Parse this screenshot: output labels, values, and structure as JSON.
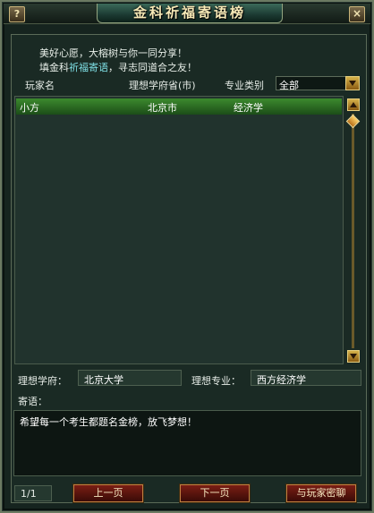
{
  "title": "金科祈福寄语榜",
  "help_label": "?",
  "close_label": "×",
  "intro": {
    "line1": "美好心愿，大榕树与你一同分享！",
    "line2_prefix": "填金科",
    "line2_highlight": "祈福寄语",
    "line2_suffix": "，寻志同道合之友！"
  },
  "header": {
    "player_col": "玩家名",
    "province_col": "理想学府省(市)",
    "major_col": "专业类别",
    "filter_value": "全部"
  },
  "rows": [
    {
      "player": "小方",
      "province": "北京市",
      "major": "经济学"
    }
  ],
  "details": {
    "school_label": "理想学府：",
    "school_value": "北京大学",
    "major_label": "理想专业：",
    "major_value": "西方经济学",
    "message_label": "寄语：",
    "message_value": "希望每一个考生都题名金榜，放飞梦想！"
  },
  "footer": {
    "page_indicator": "1/1",
    "prev_label": "上一页",
    "next_label": "下一页",
    "chat_label": "与玩家密聊"
  },
  "colors": {
    "accent_highlight": "#7fe0e6",
    "selected_row": "#3c8a2e",
    "button_bg": "#7a1e14"
  }
}
